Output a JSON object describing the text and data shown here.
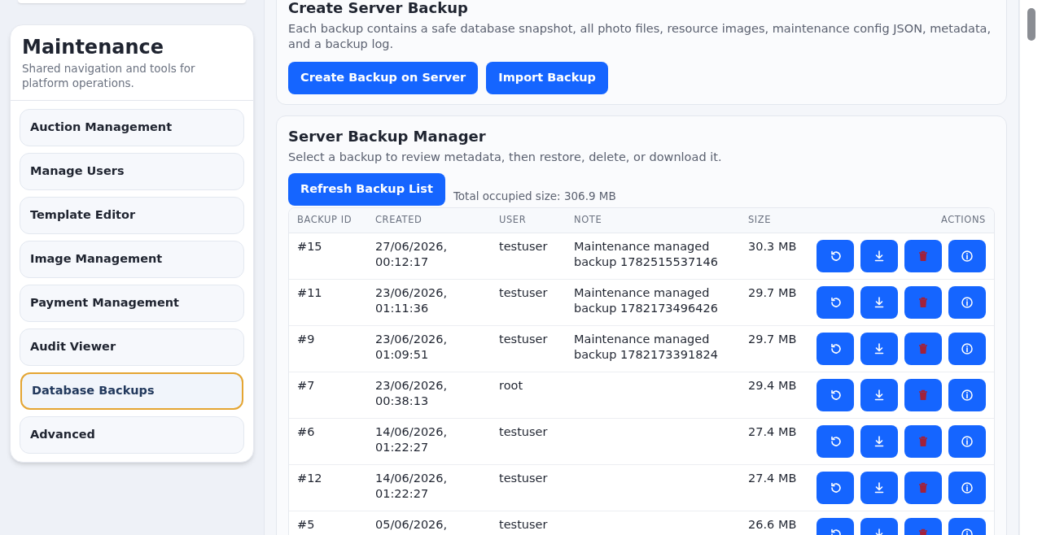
{
  "sidebar": {
    "title": "Maintenance",
    "subtitle": "Shared navigation and tools for platform operations.",
    "items": [
      {
        "label": "Auction Management",
        "selected": false
      },
      {
        "label": "Manage Users",
        "selected": false
      },
      {
        "label": "Template Editor",
        "selected": false
      },
      {
        "label": "Image Management",
        "selected": false
      },
      {
        "label": "Payment Management",
        "selected": false
      },
      {
        "label": "Audit Viewer",
        "selected": false
      },
      {
        "label": "Database Backups",
        "selected": true
      },
      {
        "label": "Advanced",
        "selected": false
      }
    ]
  },
  "create_card": {
    "title": "Create Server Backup",
    "description": "Each backup contains a safe database snapshot, all photo files, resource images, maintenance config JSON, metadata, and a backup log.",
    "buttons": [
      "Create Backup on Server",
      "Import Backup"
    ]
  },
  "manager_card": {
    "title": "Server Backup Manager",
    "description": "Select a backup to review metadata, then restore, delete, or download it.",
    "refresh_button": "Refresh Backup List",
    "total": "Total occupied size: 306.9 MB",
    "table": {
      "columns": [
        "BACKUP ID",
        "CREATED",
        "USER",
        "NOTE",
        "SIZE",
        "ACTIONS"
      ],
      "rows": [
        {
          "id": "#15",
          "created": "27/06/2026, 00:12:17",
          "user": "testuser",
          "note": "Maintenance managed backup 1782515537146",
          "size": "30.3 MB"
        },
        {
          "id": "#11",
          "created": "23/06/2026, 01:11:36",
          "user": "testuser",
          "note": "Maintenance managed backup 1782173496426",
          "size": "29.7 MB"
        },
        {
          "id": "#9",
          "created": "23/06/2026, 01:09:51",
          "user": "testuser",
          "note": "Maintenance managed backup 1782173391824",
          "size": "29.7 MB"
        },
        {
          "id": "#7",
          "created": "23/06/2026, 00:38:13",
          "user": "root",
          "size": "29.4 MB"
        },
        {
          "id": "#6",
          "created": "14/06/2026, 01:22:27",
          "user": "testuser",
          "size": "27.4 MB"
        },
        {
          "id": "#12",
          "created": "14/06/2026, 01:22:27",
          "user": "testuser",
          "size": "27.4 MB"
        },
        {
          "id": "#5",
          "created": "05/06/2026,",
          "user": "testuser",
          "size": "26.6 MB"
        }
      ]
    }
  }
}
